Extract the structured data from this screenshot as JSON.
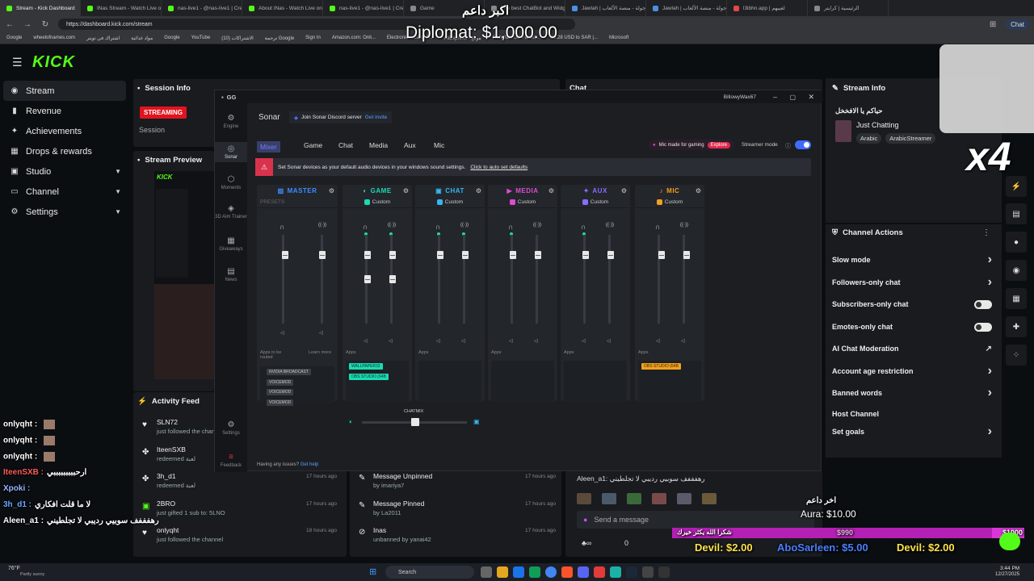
{
  "browser": {
    "tabs": [
      {
        "label": "Stream - Kick Dashboard",
        "color": "#53fc18"
      },
      {
        "label": "INas Stream - Watch Live on",
        "color": "#53fc18"
      },
      {
        "label": "nas-live1 - @nas-live1 | Crea",
        "color": "#53fc18"
      },
      {
        "label": "About INas - Watch Live on K",
        "color": "#53fc18"
      },
      {
        "label": "nas-live1 - @nas-live1 | Crea",
        "color": "#53fc18"
      },
      {
        "label": "Game",
        "color": "#888888"
      },
      {
        "label": "The best ChatBot and Widge",
        "color": "#888888"
      },
      {
        "label": "Jawlah | جولة - منصة الألعاب",
        "color": "#4a90e2"
      },
      {
        "label": "Jawlah | جولة - منصة الألعاب",
        "color": "#4a90e2"
      },
      {
        "label": "l3ibhn.app | لعيبهم",
        "color": "#e24a4a"
      },
      {
        "label": "الرئيسية | كرايتر",
        "color": "#888888"
      }
    ],
    "url": "https://dashboard.kick.com/stream",
    "chat_label": "Chat",
    "bookmarks": [
      "Google",
      "wheelofnames.com",
      "اشتراك في تويتر",
      "مواد غذائية",
      "Google",
      "YouTube",
      "الاشتراكات (10)",
      "ترجمة Google",
      "Sign In",
      "Amazon.com: Onli...",
      "Electronics, Cars, F...",
      "AliExpress - موقع",
      "Fishofast US Parcel...",
      "15.28 USD to SAR |...",
      "Microsoft"
    ]
  },
  "sidebar": {
    "items": [
      {
        "label": "Stream",
        "icon": "stream-icon",
        "chev": false
      },
      {
        "label": "Revenue",
        "icon": "revenue-icon",
        "chev": false
      },
      {
        "label": "Achievements",
        "icon": "trophy-icon",
        "chev": false
      },
      {
        "label": "Drops & rewards",
        "icon": "gift-icon",
        "chev": false
      },
      {
        "label": "Studio",
        "icon": "studio-icon",
        "chev": true
      },
      {
        "label": "Channel",
        "icon": "channel-icon",
        "chev": true
      },
      {
        "label": "Settings",
        "icon": "gear-icon",
        "chev": true
      }
    ]
  },
  "session": {
    "title": "Session Info",
    "badge": "STREAMING",
    "label": "Session"
  },
  "preview": {
    "title": "Stream Preview"
  },
  "chat_panel": {
    "title": "Chat"
  },
  "activity": {
    "title": "Activity Feed",
    "items": [
      {
        "name": "SLN72",
        "sub": "just followed the channel",
        "time": "",
        "icon": "heart-icon"
      },
      {
        "name": "IteenSXB",
        "sub": "redeemed لعبة",
        "time": "17 hours ago",
        "icon": "reward-icon"
      },
      {
        "name": "3h_d1",
        "sub": "redeemed لعبة",
        "time": "17 hours ago",
        "icon": "reward-icon"
      },
      {
        "name": "2BRO",
        "sub": "just gifted 1 sub to: 5LNO",
        "time": "17 hours ago",
        "icon": "gift-icon"
      },
      {
        "name": "onlyqht",
        "sub": "just followed the channel",
        "time": "18 hours ago",
        "icon": "heart-icon"
      }
    ]
  },
  "mod_log": [
    {
      "name": "Message Unpinned",
      "sub": "by imariya7",
      "time": "17 hours ago",
      "icon": "pin-icon"
    },
    {
      "name": "Message Pinned",
      "sub": "by La2011",
      "time": "17 hours ago",
      "icon": "pin-icon"
    },
    {
      "name": "Inas",
      "sub": "unbanned by yanai42",
      "time": "17 hours ago",
      "icon": "unban-icon"
    }
  ],
  "overlay_chat": [
    {
      "user": "onlyqht :",
      "msg": "",
      "color": "#ffffff"
    },
    {
      "user": "onlyqht :",
      "msg": "",
      "color": "#ffffff"
    },
    {
      "user": "onlyqht :",
      "msg": "",
      "color": "#ffffff"
    },
    {
      "user": "IteenSXB :",
      "msg": "ارحبببببببببي",
      "color": "#ff5a5a"
    },
    {
      "user": "Xpoki :",
      "msg": "",
      "color": "#9bb6ff"
    },
    {
      "user": "3h_d1 :",
      "msg": "لا ما قلت افكاري",
      "color": "#6aa8ff"
    },
    {
      "user": "Aleen_a1 :",
      "msg": "رهفففف سوبيي رديبي لا تجلطيني",
      "color": "#ffffff"
    }
  ],
  "gg": {
    "app_name": "GG",
    "user": "BillowyWax67",
    "nav": [
      {
        "label": "Engine",
        "icon": "engine-icon"
      },
      {
        "label": "Sonar",
        "icon": "sonar-icon"
      },
      {
        "label": "Moments",
        "icon": "moments-icon"
      },
      {
        "label": "3D Aim Trainer",
        "icon": "aim-icon"
      },
      {
        "label": "Giveaways",
        "icon": "giveaway-icon"
      },
      {
        "label": "News",
        "icon": "news-icon"
      },
      {
        "label": "Settings",
        "icon": "gear-icon"
      },
      {
        "label": "Feedback",
        "icon": "feedback-icon"
      }
    ],
    "sonar_title": "Sonar",
    "discord_text": "Join Sonar Discord server",
    "discord_link": "Get invite",
    "tabs": [
      "Mixer",
      "Game",
      "Chat",
      "Media",
      "Aux",
      "Mic"
    ],
    "mic_promo": "Mic made for gaming",
    "explore": "Explore",
    "streamer_mode": "Streamer mode",
    "banner_text": "Set Sonar devices as your default audio devices in your windows sound settings.",
    "banner_link": "Click to auto set defaults",
    "channels": [
      {
        "name": "MASTER",
        "sub": "PRESETS",
        "color": "#3f8cff",
        "icon": "master-icon"
      },
      {
        "name": "GAME",
        "sub": "Custom",
        "color": "#1bdab2",
        "icon": "game-icon"
      },
      {
        "name": "CHAT",
        "sub": "Custom",
        "color": "#35b6f0",
        "icon": "chat-icon"
      },
      {
        "name": "MEDIA",
        "sub": "Custom",
        "color": "#e04bd0",
        "icon": "media-icon"
      },
      {
        "name": "AUX",
        "sub": "Custom",
        "color": "#8b6cff",
        "icon": "aux-icon"
      },
      {
        "name": "MIC",
        "sub": "Custom",
        "color": "#f0a020",
        "icon": "mic-icon"
      }
    ],
    "apps_label": "Apps",
    "apps_routed": "Apps to be routed",
    "learn_more": "Learn more",
    "master_apps": [
      "NVIDIA BROADCAST",
      "VOICEMOD",
      "VOICEMOD",
      "VOICEMOD"
    ],
    "game_apps": [
      "WALLPAPER32",
      "OBS STUDIO (64B"
    ],
    "mic_apps": [
      "OBS STUDIO (64B"
    ],
    "chatmix": "CHATMIX",
    "issues": "Having any issues?",
    "get_help": "Get help"
  },
  "stream_info": {
    "title": "Stream Info",
    "stream_title": "حياكم يا الافخخل",
    "category": "Just Chatting",
    "tags": [
      "Arabic",
      "ArabicStreamer"
    ]
  },
  "channel_actions": {
    "title": "Channel Actions",
    "items": [
      {
        "label": "Slow mode",
        "kind": "chev"
      },
      {
        "label": "Followers-only chat",
        "kind": "chev"
      },
      {
        "label": "Subscribers-only chat",
        "kind": "toggle"
      },
      {
        "label": "Emotes-only chat",
        "kind": "toggle"
      },
      {
        "label": "AI Chat Moderation",
        "kind": "ext"
      },
      {
        "label": "Account age restriction",
        "kind": "chev"
      },
      {
        "label": "Banned words",
        "kind": "chev"
      },
      {
        "label": "Host Channel",
        "kind": "none"
      },
      {
        "label": "Set goals",
        "kind": "chev"
      }
    ]
  },
  "chat_input": {
    "placeholder": "Send a message",
    "chat_btn": "Chat",
    "count": "0",
    "last_msg": "Aleen_a1: رهفففف سوبيي رديبي لا تجلطيني"
  },
  "overlays": {
    "top_name": "اكبر داعم",
    "top_amount": "Diplomat: $1,000.00",
    "x4": "x4",
    "aura_name": "اخر داعم",
    "aura": "Aura: $10.00",
    "goal_text": "شكرا الله يكثر خيرك",
    "goal_mid": "$990",
    "goal_end": "$1000",
    "bottom": [
      "Devil: $2.00",
      "AboSarleen: $5.00",
      "Devil: $2.00"
    ]
  },
  "taskbar": {
    "weather": "76°F",
    "weather_sub": "Partly sunny",
    "search": "Search",
    "time": "3:44 PM",
    "date": "12/27/2025"
  }
}
